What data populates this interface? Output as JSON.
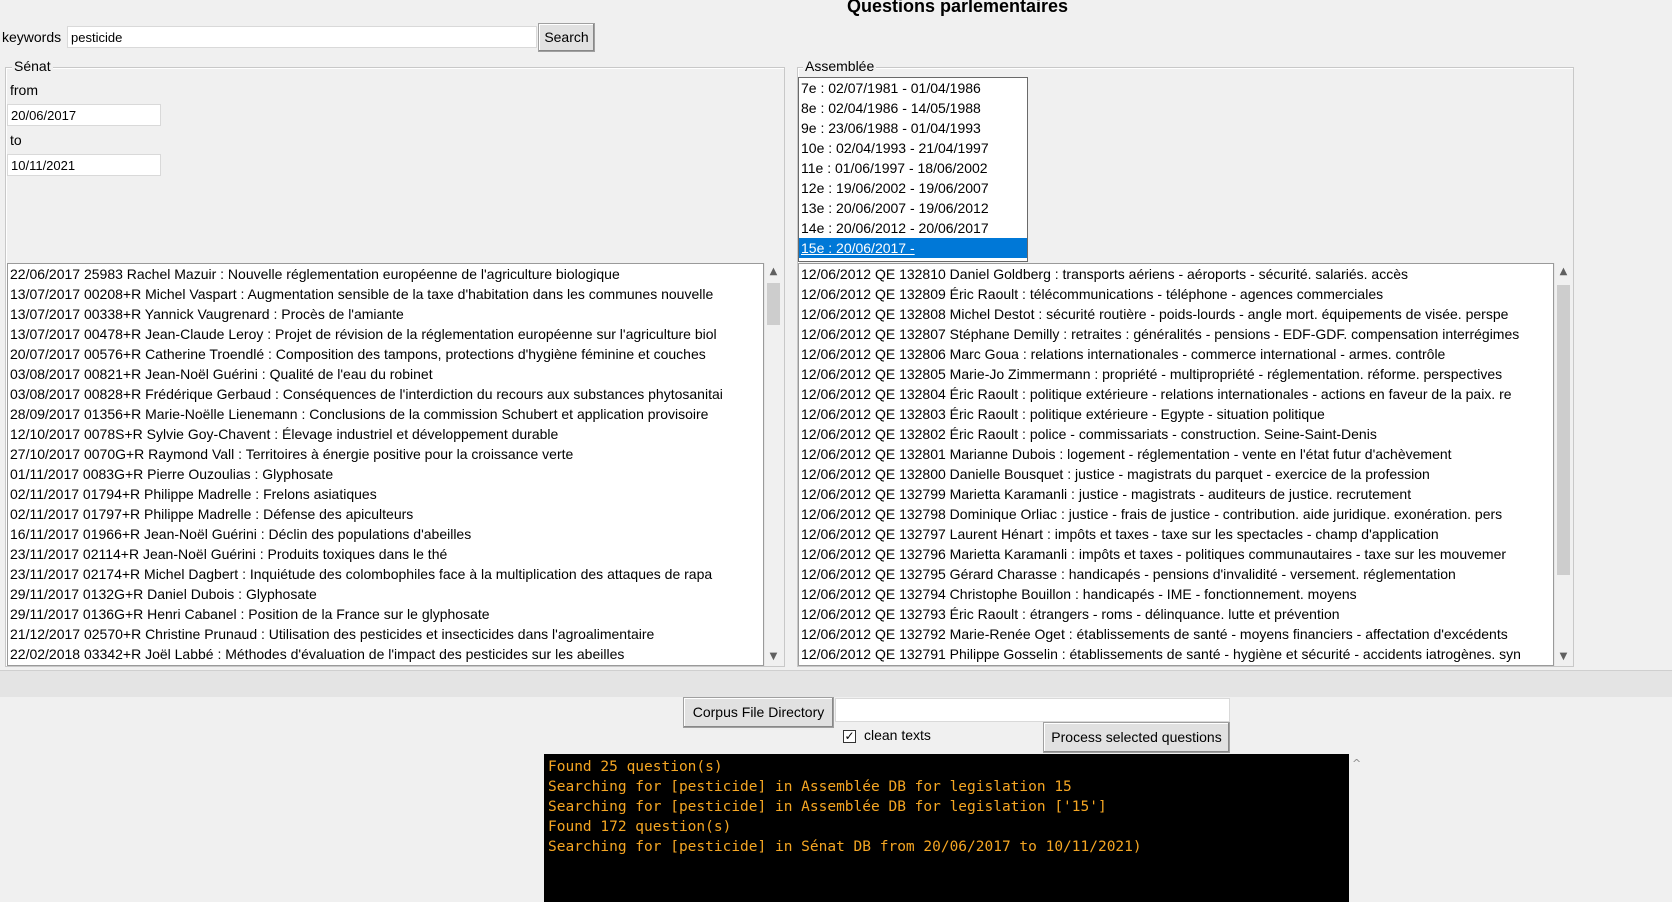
{
  "title": "Questions parlementaires",
  "search": {
    "keywords_label": "keywords",
    "keywords_value": "pesticide",
    "search_button": "Search"
  },
  "senat": {
    "frame_label": "Sénat",
    "from_label": "from",
    "from_value": "20/06/2017",
    "to_label": "to",
    "to_value": "10/11/2021",
    "results": [
      "22/06/2017 25983   Rachel Mazuir : Nouvelle réglementation européenne de l'agriculture biologique",
      "13/07/2017 00208+R   Michel Vaspart : Augmentation sensible de la taxe d'habitation dans les communes nouvelle",
      "13/07/2017 00338+R   Yannick Vaugrenard : Procès de l'amiante",
      "13/07/2017 00478+R   Jean-Claude Leroy : Projet de révision de la réglementation européenne sur l'agriculture biol",
      "20/07/2017 00576+R   Catherine Troendlé : Composition des tampons, protections d'hygiène féminine et couches",
      "03/08/2017 00821+R   Jean-Noël Guérini : Qualité de l'eau du robinet",
      "03/08/2017 00828+R   Frédérique Gerbaud : Conséquences de l'interdiction du recours aux substances phytosanitai",
      "28/09/2017 01356+R   Marie-Noëlle Lienemann : Conclusions de la commission Schubert et application provisoire",
      "12/10/2017 0078S+R   Sylvie Goy-Chavent : Élevage industriel et développement durable",
      "27/10/2017 0070G+R   Raymond Vall : Territoires à énergie positive pour la croissance verte",
      "01/11/2017 0083G+R   Pierre Ouzoulias : Glyphosate",
      "02/11/2017 01794+R   Philippe Madrelle : Frelons asiatiques",
      "02/11/2017 01797+R   Philippe Madrelle : Défense des apiculteurs",
      "16/11/2017 01966+R   Jean-Noël Guérini : Déclin des populations d'abeilles",
      "23/11/2017 02114+R   Jean-Noël Guérini : Produits toxiques dans le thé",
      "23/11/2017 02174+R   Michel Dagbert : Inquiétude des colombophiles face à la multiplication des attaques de rapa",
      "29/11/2017 0132G+R   Daniel Dubois : Glyphosate",
      "29/11/2017 0136G+R   Henri Cabanel : Position de la France sur le glyphosate",
      "21/12/2017 02570+R   Christine Prunaud : Utilisation des pesticides et insecticides dans l'agroalimentaire",
      "22/02/2018 03342+R   Joël Labbé : Méthodes d'évaluation de l'impact des pesticides sur les abeilles"
    ]
  },
  "assemblee": {
    "frame_label": "Assemblée",
    "legislatures": [
      "7e : 02/07/1981 - 01/04/1986",
      "8e : 02/04/1986 - 14/05/1988",
      "9e : 23/06/1988 - 01/04/1993",
      "10e : 02/04/1993 - 21/04/1997",
      "11e : 01/06/1997 - 18/06/2002",
      "12e : 19/06/2002 - 19/06/2007",
      "13e : 20/06/2007 - 19/06/2012",
      "14e : 20/06/2012 - 20/06/2017",
      "15e : 20/06/2017 -"
    ],
    "selected_index": 8,
    "results": [
      "12/06/2012 QE 132810   Daniel Goldberg : transports aériens - aéroports - sécurité. salariés. accès",
      "12/06/2012 QE 132809   Éric Raoult : télécommunications - téléphone - agences commerciales",
      "12/06/2012 QE 132808   Michel Destot : sécurité routière - poids-lourds - angle mort. équipements de visée. perspe",
      "12/06/2012 QE 132807   Stéphane Demilly : retraites : généralités - pensions - EDF-GDF. compensation interrégimes",
      "12/06/2012 QE 132806   Marc Goua : relations internationales - commerce international - armes. contrôle",
      "12/06/2012 QE 132805   Marie-Jo Zimmermann : propriété - multipropriété - réglementation. réforme. perspectives",
      "12/06/2012 QE 132804   Éric Raoult : politique extérieure - relations internationales - actions en faveur de la paix. re",
      "12/06/2012 QE 132803   Éric Raoult : politique extérieure - Egypte - situation politique",
      "12/06/2012 QE 132802   Éric Raoult : police - commissariats - construction. Seine-Saint-Denis",
      "12/06/2012 QE 132801   Marianne Dubois : logement - réglementation - vente en l'état futur d'achèvement",
      "12/06/2012 QE 132800   Danielle Bousquet : justice - magistrats du parquet - exercice de la profession",
      "12/06/2012 QE 132799   Marietta Karamanli : justice - magistrats - auditeurs de justice. recrutement",
      "12/06/2012 QE 132798   Dominique Orliac : justice - frais de justice - contribution. aide juridique. exonération. pers",
      "12/06/2012 QE 132797   Laurent Hénart : impôts et taxes - taxe sur les spectacles - champ d'application",
      "12/06/2012 QE 132796   Marietta Karamanli : impôts et taxes - politiques communautaires - taxe sur les mouvemer",
      "12/06/2012 QE 132795   Gérard Charasse : handicapés - pensions d'invalidité - versement. réglementation",
      "12/06/2012 QE 132794   Christophe Bouillon : handicapés - IME - fonctionnement. moyens",
      "12/06/2012 QE 132793   Éric Raoult : étrangers - roms - délinquance. lutte et prévention",
      "12/06/2012 QE 132792   Marie-Renée Oget : établissements de santé - moyens financiers - affectation d'excédents",
      "12/06/2012 QE 132791   Philippe Gosselin : établissements de santé - hygiène et sécurité - accidents iatrogènes. syn"
    ]
  },
  "bottom": {
    "corpus_button": "Corpus File Directory",
    "corpus_value": "",
    "clean_texts_label": "clean texts",
    "clean_texts_checked": true,
    "process_button": "Process selected questions"
  },
  "console": [
    "Found 25 question(s)",
    "Searching for [pesticide] in Assemblée DB for legislation 15",
    "Searching for [pesticide] in Assemblée DB for legislation ['15']",
    "Found 172 question(s)",
    "Searching for [pesticide] in Sénat DB from 20/06/2017 to 10/11/2021)"
  ],
  "colors": {
    "selection": "#0078d7",
    "console_bg": "#000000",
    "console_fg": "#f5a623"
  }
}
